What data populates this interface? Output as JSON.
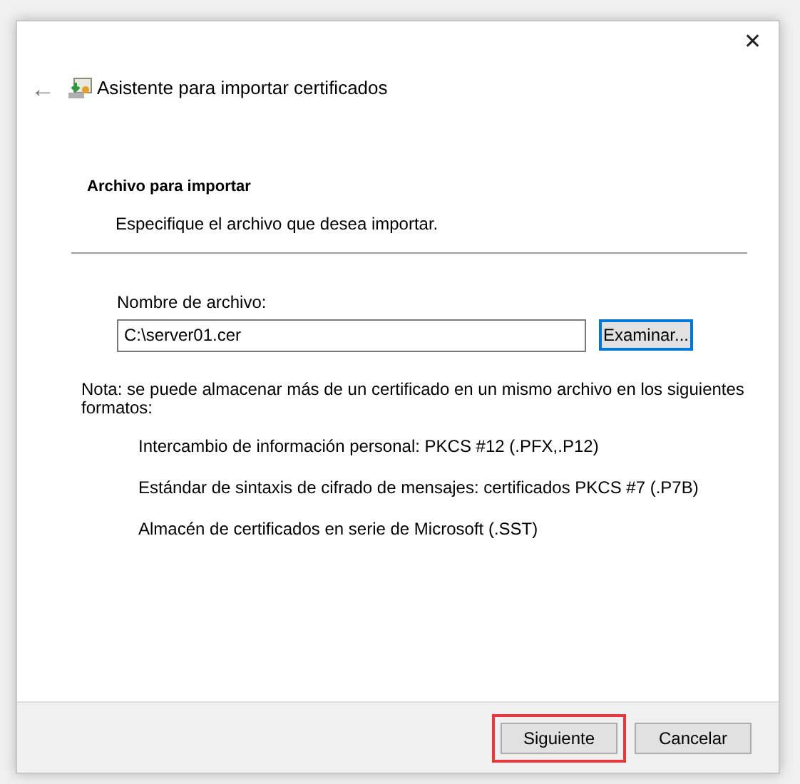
{
  "window": {
    "title": "Asistente para importar certificados",
    "close": "✕",
    "back": "←"
  },
  "header": {
    "title": "Archivo para importar",
    "subtitle": "Especifique el archivo que desea importar."
  },
  "file_field": {
    "label": "Nombre de archivo:",
    "value": "C:\\server01.cer",
    "browse_button": {
      "label": "Examinar...",
      "focused": true
    }
  },
  "note": "Nota: se puede almacenar más de un certificado en un mismo archivo en los siguientes formatos:",
  "formats": [
    "Intercambio de información personal: PKCS #12 (.PFX,.P12)",
    "Estándar de sintaxis de cifrado de mensajes: certificados PKCS #7 (.P7B)",
    "Almacén de certificados en serie de Microsoft (.SST)"
  ],
  "buttons": [
    {
      "label": "Siguiente",
      "highlighted": true
    },
    {
      "label": "Cancelar",
      "highlighted": false
    }
  ]
}
